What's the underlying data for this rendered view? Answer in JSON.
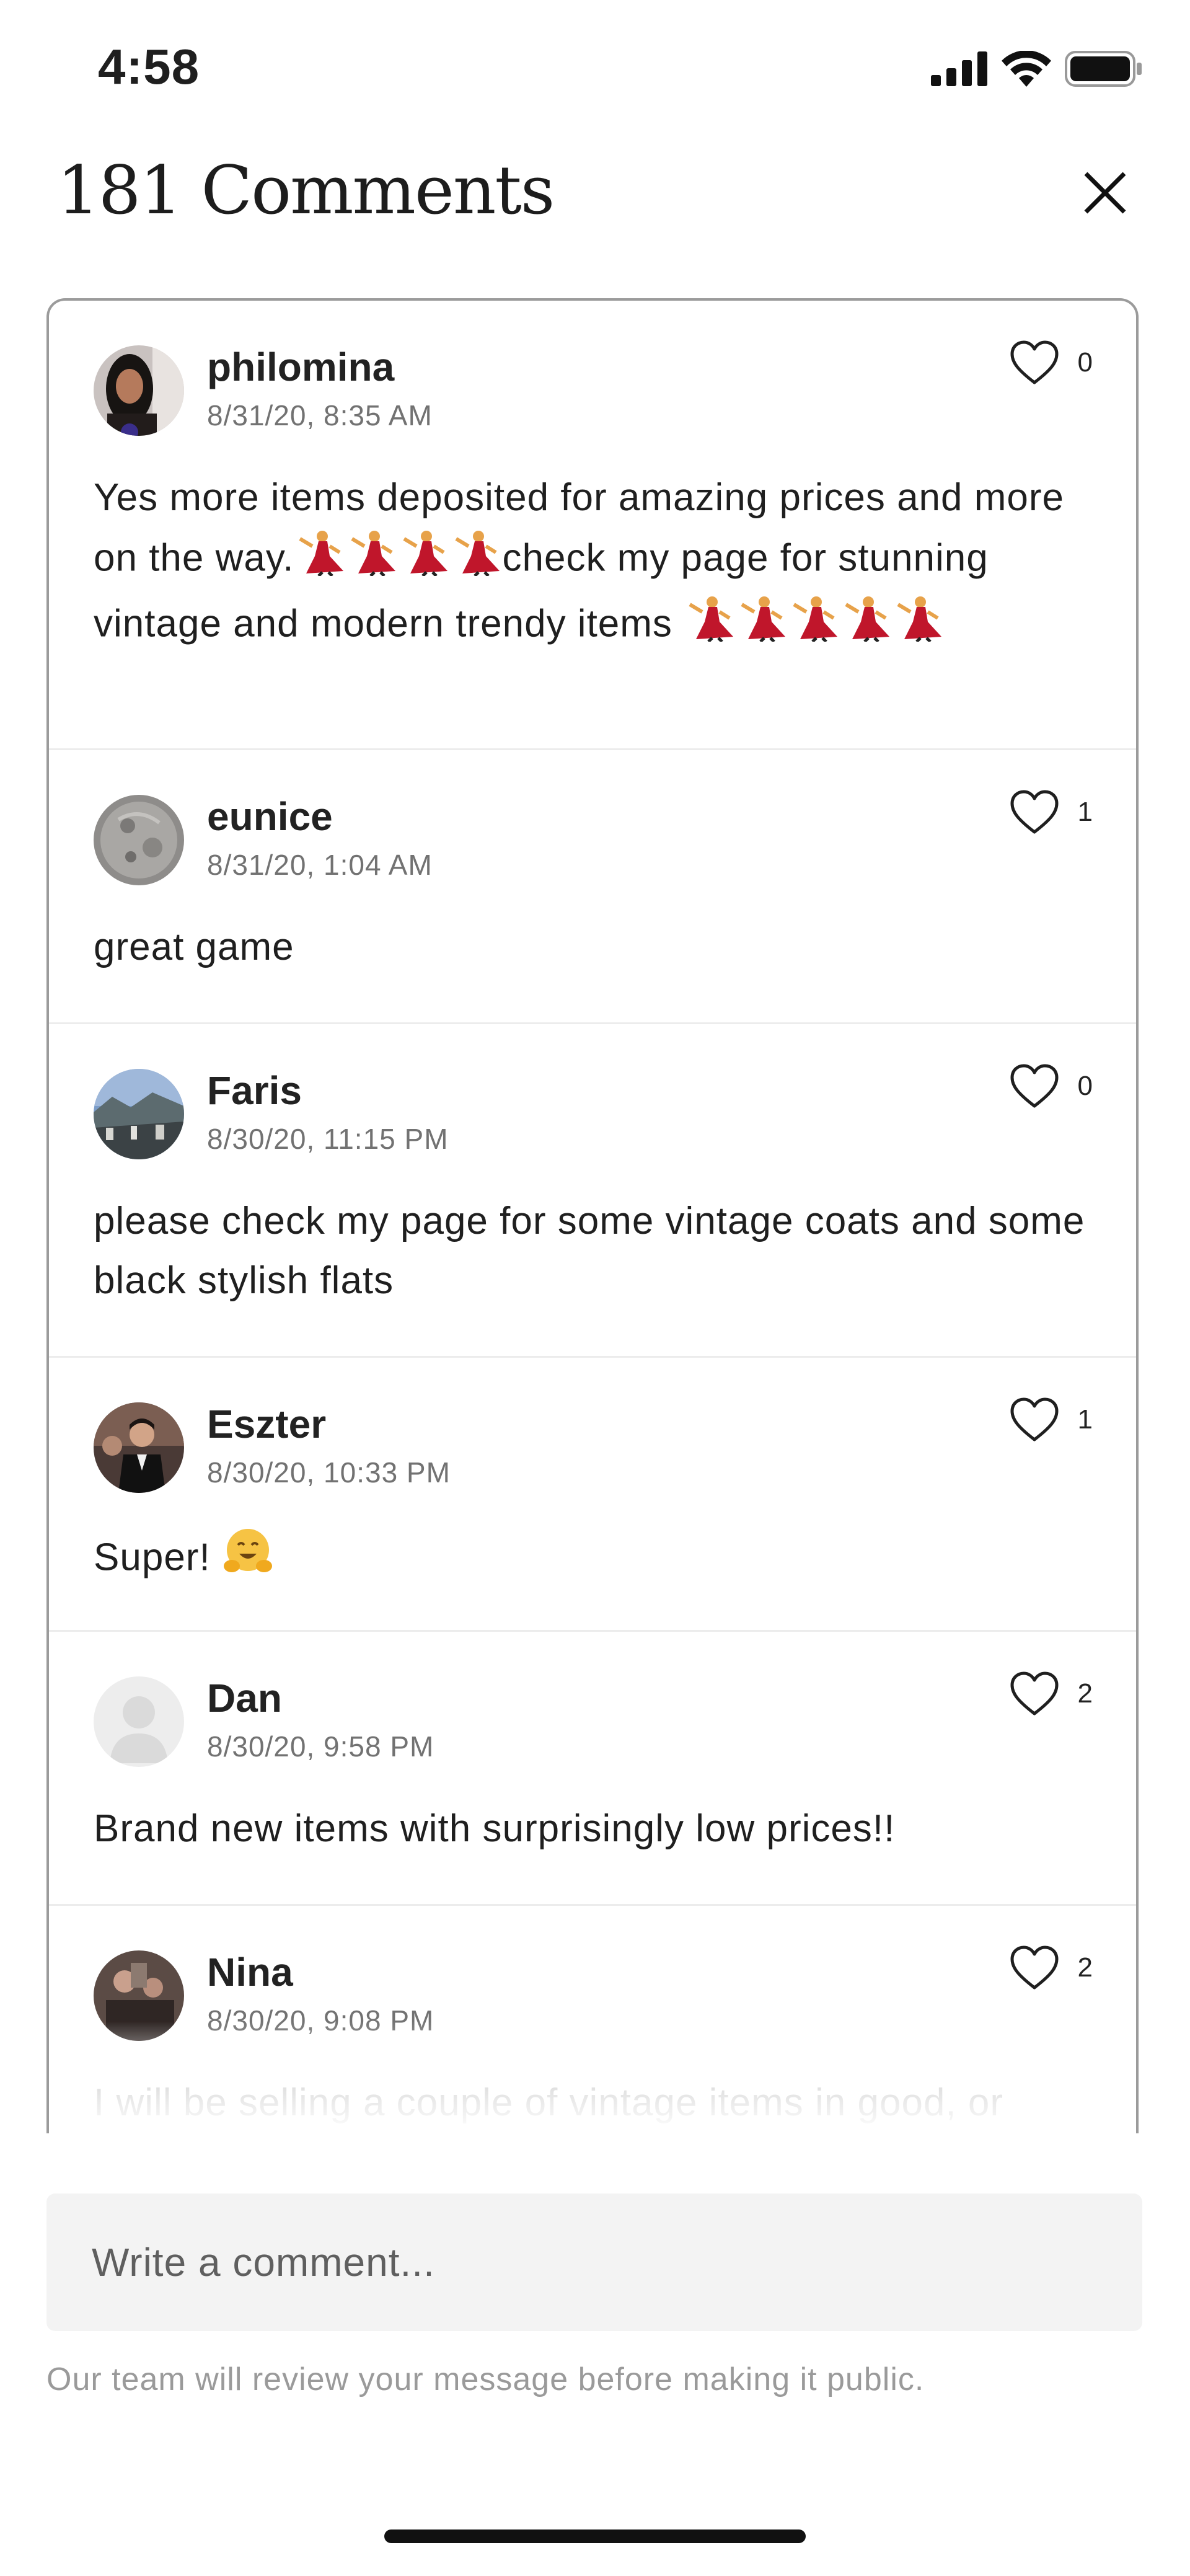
{
  "status_bar": {
    "time": "4:58"
  },
  "header": {
    "title": "181 Comments"
  },
  "comments": [
    {
      "username": "philomina",
      "timestamp": "8/31/20, 8:35 AM",
      "likes": "0",
      "text_a": "Yes more items deposited for amazing prices and more on the way.",
      "text_b": "check my page for stunning vintage and modern trendy items "
    },
    {
      "username": "eunice",
      "timestamp": "8/31/20, 1:04 AM",
      "likes": "1",
      "text_a": "great game"
    },
    {
      "username": "Faris",
      "timestamp": "8/30/20, 11:15 PM",
      "likes": "0",
      "text_a": "please check my page for some vintage coats and some black stylish flats"
    },
    {
      "username": "Eszter",
      "timestamp": "8/30/20, 10:33 PM",
      "likes": "1",
      "text_a": "Super! "
    },
    {
      "username": "Dan",
      "timestamp": "8/30/20, 9:58 PM",
      "likes": "2",
      "text_a": "Brand new items with surprisingly low prices!!"
    },
    {
      "username": "Nina",
      "timestamp": "8/30/20, 9:08 PM",
      "likes": "2",
      "text_a": "I will be selling a couple of vintage items in good, or"
    }
  ],
  "composer": {
    "placeholder": "Write a comment..."
  },
  "footer": {
    "review_note": "Our team will review your message before making it public."
  },
  "icons": {
    "dancer": "dancer-emoji",
    "hugging": "hugging-face-emoji",
    "heart": "heart-outline-icon",
    "close": "close-icon"
  }
}
